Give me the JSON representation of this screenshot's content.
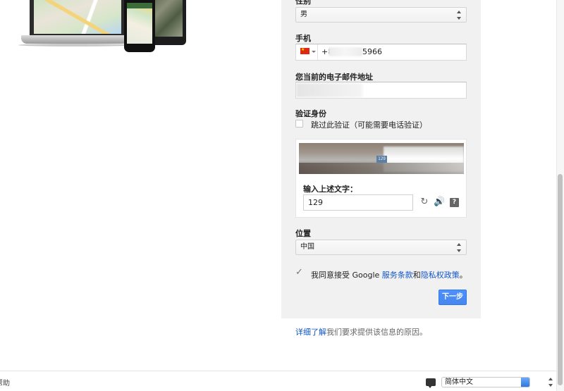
{
  "gender": {
    "label": "性别",
    "value": "男"
  },
  "phone": {
    "label": "手机",
    "country": "CN",
    "prefix": "+8",
    "suffix": "5966"
  },
  "email": {
    "label": "您当前的电子邮件地址",
    "value": ""
  },
  "verify": {
    "label": "验证身份",
    "skip_label": "跳过此验证（可能需要电话验证）",
    "skip_checked": false
  },
  "captcha": {
    "image_text": "129",
    "prompt": "输入上述文字：",
    "input_value": "129",
    "refresh_icon": "refresh-icon",
    "audio_icon": "audio-icon",
    "help_icon": "help-icon",
    "help_glyph": "?"
  },
  "location": {
    "label": "位置",
    "value": "中国"
  },
  "terms": {
    "checked": true,
    "check_glyph": "✓",
    "prefix": "我同意接受 Google ",
    "tos_link": "服务条款",
    "conjunction": "和",
    "privacy_link": "隐私权政策",
    "suffix": "。"
  },
  "next_button": "下一步",
  "learn_more": {
    "link": "详细了解",
    "text": "我们要求提供该信息的原因。"
  },
  "footer": {
    "help_fragment": "帮助",
    "language": "简体中文",
    "chat_icon": "chat-bubble-icon"
  },
  "colors": {
    "link": "#1155cc",
    "primary_button": "#4d90fe",
    "panel_bg": "#f1f1f1"
  }
}
